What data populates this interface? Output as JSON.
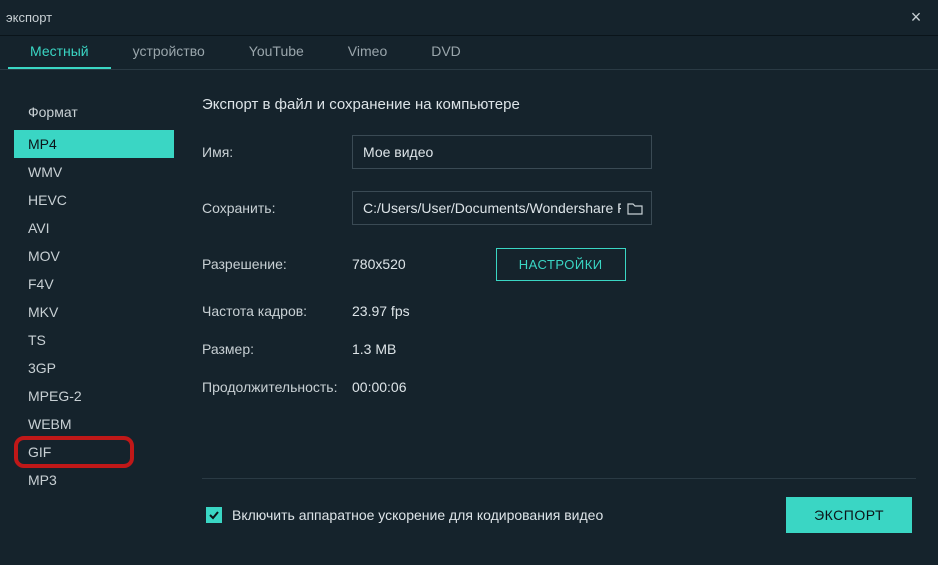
{
  "titlebar": {
    "title": "экспорт",
    "close": "×"
  },
  "tabs": [
    {
      "label": "Местный",
      "active": true
    },
    {
      "label": "устройство",
      "active": false
    },
    {
      "label": "YouTube",
      "active": false
    },
    {
      "label": "Vimeo",
      "active": false
    },
    {
      "label": "DVD",
      "active": false
    }
  ],
  "sidebar": {
    "heading": "Формат",
    "formats": [
      {
        "label": "MP4",
        "selected": true
      },
      {
        "label": "WMV"
      },
      {
        "label": "HEVC"
      },
      {
        "label": "AVI"
      },
      {
        "label": "MOV"
      },
      {
        "label": "F4V"
      },
      {
        "label": "MKV"
      },
      {
        "label": "TS"
      },
      {
        "label": "3GP"
      },
      {
        "label": "MPEG-2"
      },
      {
        "label": "WEBM"
      },
      {
        "label": "GIF",
        "highlighted": true
      },
      {
        "label": "MP3"
      }
    ]
  },
  "main": {
    "heading": "Экспорт в файл и сохранение на компьютере",
    "name_label": "Имя:",
    "name_value": "Мое видео",
    "save_label": "Сохранить:",
    "save_path": "C:/Users/User/Documents/Wondershare Filmora",
    "resolution_label": "Разрешение:",
    "resolution_value": "780x520",
    "settings_button": "НАСТРОЙКИ",
    "fps_label": "Частота кадров:",
    "fps_value": "23.97 fps",
    "size_label": "Размер:",
    "size_value": "1.3 MB",
    "duration_label": "Продолжительность:",
    "duration_value": "00:00:06"
  },
  "bottom": {
    "checkbox_label": "Включить аппаратное ускорение для кодирования видео",
    "checkbox_checked": true,
    "export_button": "ЭКСПОРТ"
  }
}
